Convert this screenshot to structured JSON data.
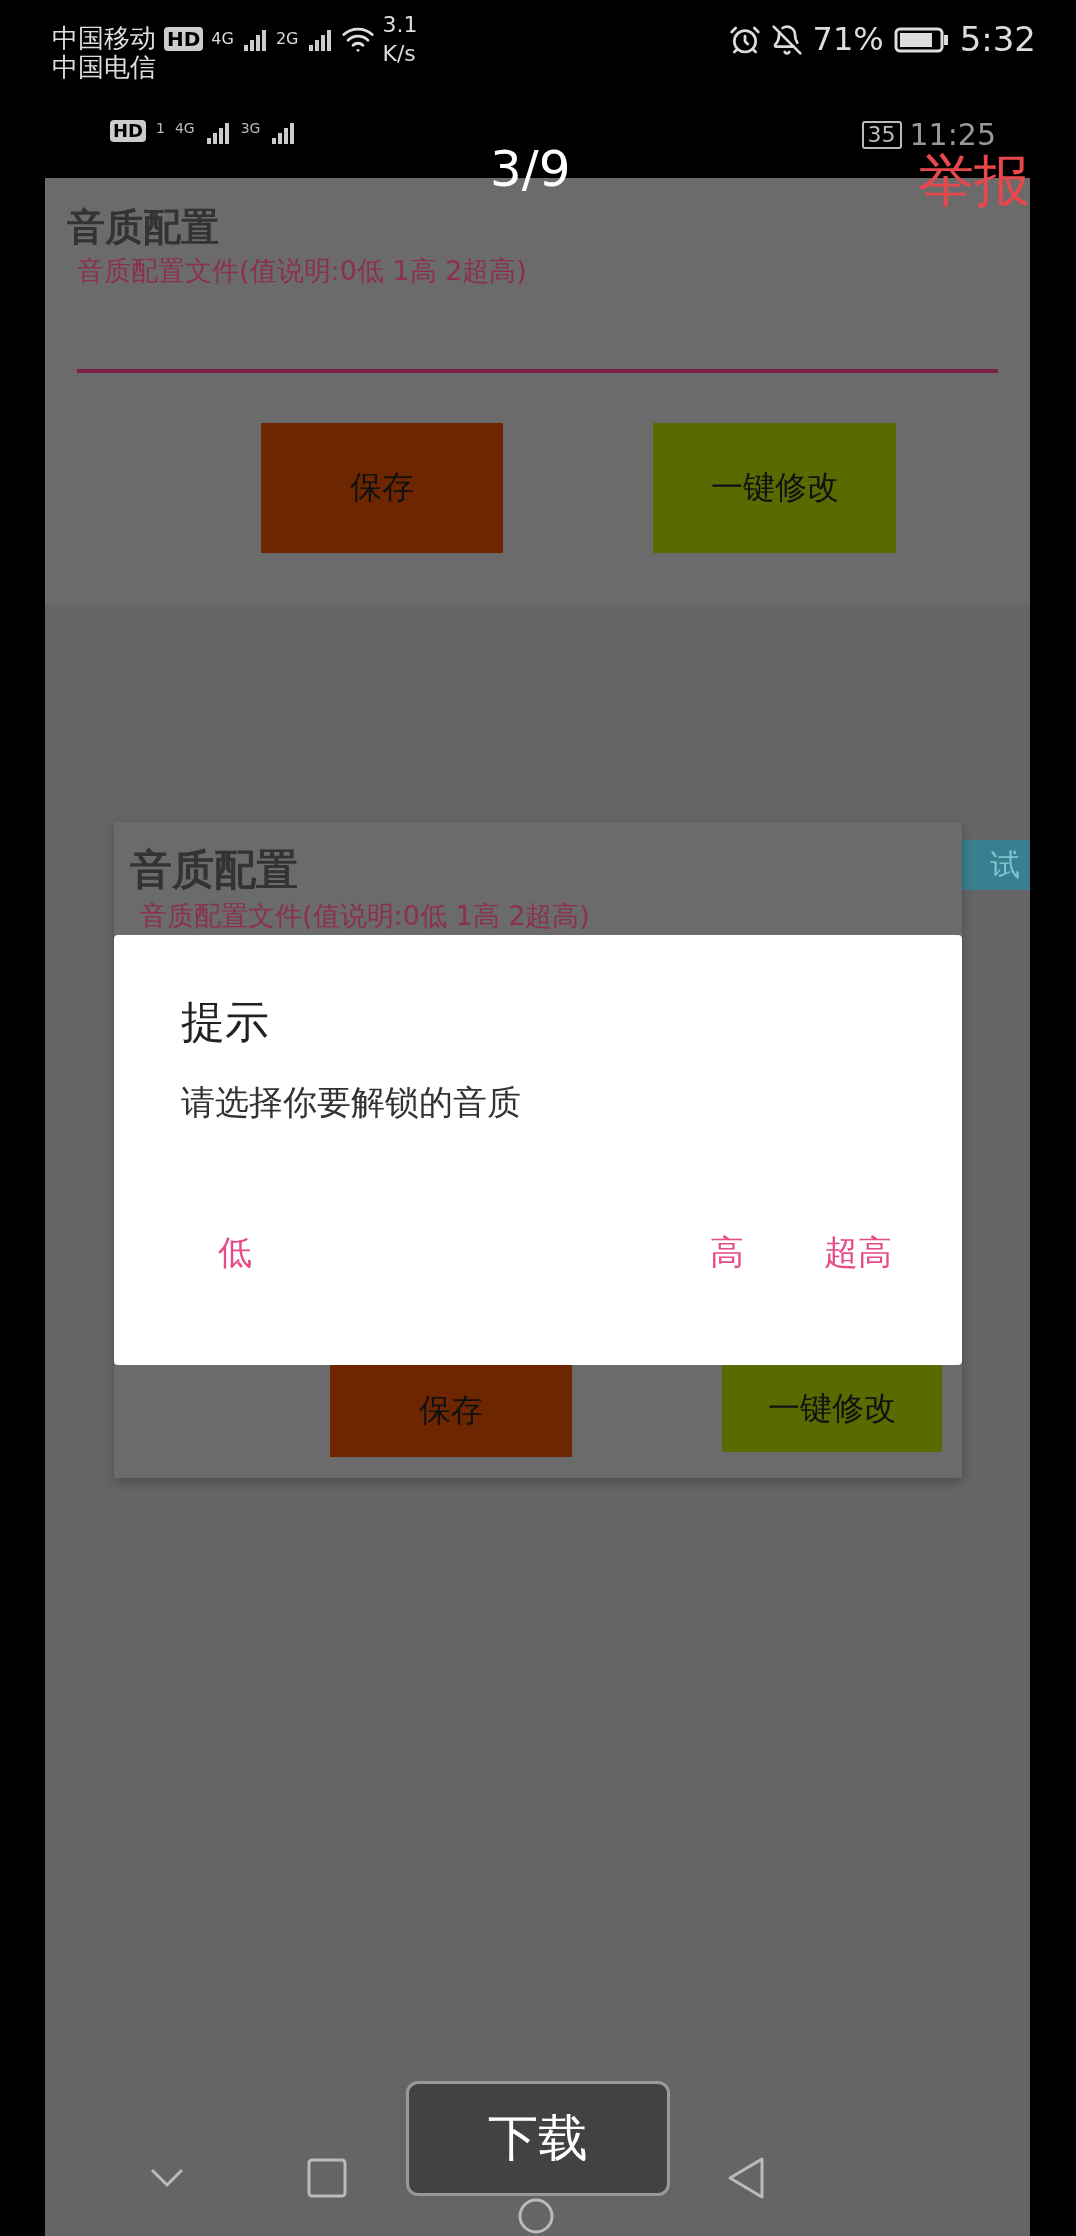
{
  "status_bar": {
    "carrier_1": "中国移动",
    "hd_badge": "HD",
    "network_1": "4G",
    "network_2": "2G",
    "speed_value": "3.1",
    "speed_unit": "K/s",
    "carrier_2": "中国电信",
    "battery": "71%",
    "time": "5:32"
  },
  "viewer": {
    "counter": "3/9",
    "report": "举报",
    "download": "下载"
  },
  "screenshot": {
    "status_bar": {
      "hd_badge": "HD",
      "sim": "1",
      "network_1": "4G",
      "network_2": "3G",
      "battery": "35",
      "time": "11:25"
    },
    "page": {
      "title": "音质配置",
      "subtitle": "音质配置文件(值说明:0低 1高 2超高)",
      "buttons": [
        {
          "label": "保存",
          "kind": "save"
        },
        {
          "label": "一键修改",
          "kind": "modify"
        }
      ]
    },
    "card": {
      "tag": "试",
      "title": "音质配置",
      "subtitle": "音质配置文件(值说明:0低 1高 2超高)",
      "buttons": [
        {
          "label": "保存",
          "kind": "save"
        },
        {
          "label": "一键修改",
          "kind": "modify"
        }
      ]
    },
    "dialog": {
      "title": "提示",
      "message": "请选择你要解锁的音质",
      "buttons": [
        "低",
        "高",
        "超高"
      ]
    }
  }
}
